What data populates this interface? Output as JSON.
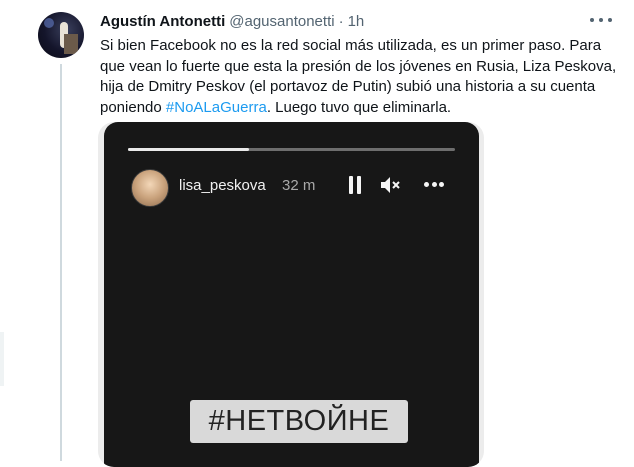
{
  "tweet": {
    "author_name": "Agustín Antonetti",
    "author_handle": "@agusantonetti",
    "separator": "·",
    "time": "1h",
    "text_before": "Si bien Facebook no es la red social más utilizada, es un primer paso. Para que vean lo fuerte que esta la presión de los jóvenes en Rusia, Liza Peskova, hija de Dmitry Peskov (el portavoz de Putin) subió una historia a su cuenta poniendo ",
    "hashtag": "#NoALaGuerra",
    "text_after": ". Luego tuvo que eliminarla.",
    "more_icon": "more-horizontal-icon",
    "hashtag_color": "#1d9bf0"
  },
  "story": {
    "username": "lisa_peskova",
    "time": "32 m",
    "progress_fraction": 0.37,
    "sticker_text": "#НЕТВОЙНЕ",
    "controls": [
      "pause-icon",
      "mute-icon",
      "more-horizontal-icon"
    ]
  }
}
